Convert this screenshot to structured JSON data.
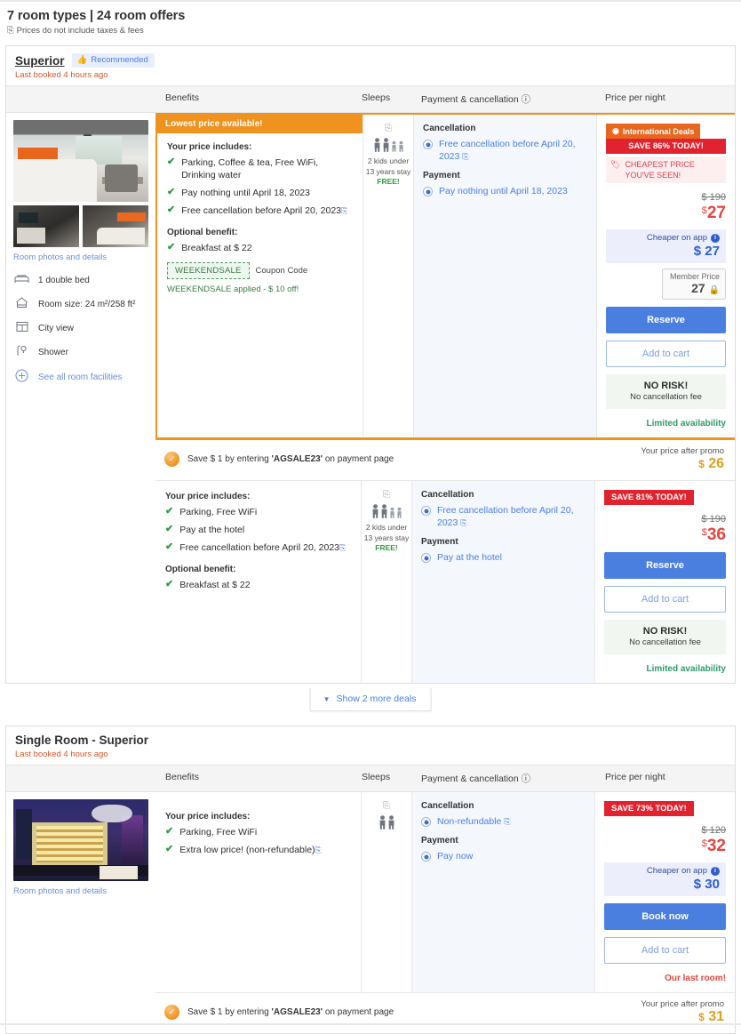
{
  "header": {
    "title": "7 room types | 24 room offers",
    "subtitle": "Prices do not include taxes & fees",
    "subtitle_icon": "external-link-icon"
  },
  "columns": {
    "benefits": "Benefits",
    "sleeps": "Sleeps",
    "payment": "Payment & cancellation",
    "payment_info_icon": "info-icon",
    "price": "Price per night"
  },
  "rooms": [
    {
      "title": "Superior",
      "recommended_badge": "Recommended",
      "recommended_icon": "thumbs-up-icon",
      "last_booked": "Last booked 4 hours ago",
      "photos_link": "Room photos and details",
      "facilities": [
        {
          "icon": "bed-icon",
          "label": "1 double bed"
        },
        {
          "icon": "room-size-icon",
          "label": "Room size: 24 m²/258 ft²"
        },
        {
          "icon": "window-icon",
          "label": "City view"
        },
        {
          "icon": "shower-icon",
          "label": "Shower"
        },
        {
          "icon": "plus-circle-icon",
          "label": "See all room facilities"
        }
      ],
      "offers": [
        {
          "promoted": true,
          "lowest_banner": "Lowest price available!",
          "includes_heading": "Your price includes:",
          "includes": [
            "Parking, Coffee & tea, Free WiFi, Drinking water",
            "Pay nothing until April 18, 2023",
            "Free cancellation before April 20, 2023"
          ],
          "optional_heading": "Optional benefit:",
          "optional": [
            "Breakfast at $ 22"
          ],
          "coupon_code": "WEEKENDSALE",
          "coupon_label": "Coupon Code",
          "coupon_applied": "WEEKENDSALE applied - $ 10 off!",
          "sleeps": {
            "gallery_icon": "photo-icon",
            "adults": 2,
            "kids": 2,
            "note": "2 kids under 13 years stay",
            "free": "FREE!"
          },
          "cancellation_heading": "Cancellation",
          "cancellation_value": "Free cancellation before April 20, 2023",
          "payment_heading": "Payment",
          "payment_value": "Pay nothing until April 18, 2023",
          "international_deal": "International Deals",
          "international_deal_icon": "clock-icon",
          "save_today": "SAVE 86% TODAY!",
          "cheapest_flag": "CHEAPEST PRICE YOU'VE SEEN!",
          "cheapest_icon": "tag-icon",
          "strike_price": "$ 190",
          "currency": "$",
          "price": "27",
          "app_label": "Cheaper on app",
          "app_price": "$ 27",
          "member_label": "Member Price",
          "member_price": "27",
          "member_lock_icon": "lock-icon",
          "reserve_label": "Reserve",
          "cart_label": "Add to cart",
          "norisk_title": "NO RISK!",
          "norisk_sub": "No cancellation fee",
          "availability": "Limited availability",
          "promo_text_pre": "Save $ 1 by entering ",
          "promo_code": "'AGSALE23'",
          "promo_text_post": " on payment page",
          "promo_after_label": "Your price after promo",
          "promo_after_price": "26",
          "promo_currency": "$"
        },
        {
          "promoted": false,
          "includes_heading": "Your price includes:",
          "includes": [
            "Parking, Free WiFi",
            "Pay at the hotel",
            "Free cancellation before April 20, 2023"
          ],
          "optional_heading": "Optional benefit:",
          "optional": [
            "Breakfast at $ 22"
          ],
          "sleeps": {
            "gallery_icon": "photo-icon",
            "adults": 2,
            "kids": 2,
            "note": "2 kids under 13 years stay",
            "free": "FREE!"
          },
          "cancellation_heading": "Cancellation",
          "cancellation_value": "Free cancellation before April 20, 2023",
          "payment_heading": "Payment",
          "payment_value": "Pay at the hotel",
          "save_today": "SAVE 81% TODAY!",
          "strike_price": "$ 190",
          "currency": "$",
          "price": "36",
          "reserve_label": "Reserve",
          "cart_label": "Add to cart",
          "norisk_title": "NO RISK!",
          "norisk_sub": "No cancellation fee",
          "availability": "Limited availability"
        }
      ],
      "show_more": "Show 2 more deals",
      "show_more_icon": "chevron-down-icon"
    },
    {
      "title": "Single Room - Superior",
      "last_booked": "Last booked 4 hours ago",
      "photos_link": "Room photos and details",
      "offers": [
        {
          "promoted": false,
          "includes_heading": "Your price includes:",
          "includes": [
            "Parking, Free WiFi",
            "Extra low price! (non-refundable)"
          ],
          "sleeps": {
            "gallery_icon": "photo-icon",
            "adults": 2,
            "kids": 0
          },
          "cancellation_heading": "Cancellation",
          "cancellation_value": "Non-refundable",
          "payment_heading": "Payment",
          "payment_value": "Pay now",
          "save_today": "SAVE 73% TODAY!",
          "strike_price": "$ 120",
          "currency": "$",
          "price": "32",
          "app_label": "Cheaper on app",
          "app_price": "$ 30",
          "book_label": "Book now",
          "cart_label": "Add to cart",
          "availability": "Our last room!",
          "promo_text_pre": "Save $ 1 by entering ",
          "promo_code": "'AGSALE23'",
          "promo_text_post": " on payment page",
          "promo_after_label": "Your price after promo",
          "promo_after_price": "31",
          "promo_currency": "$"
        }
      ]
    }
  ],
  "colors": {
    "orange": "#f0921e",
    "red": "#e0232e",
    "blue": "#4a7fe0",
    "green": "#2e9b3f",
    "gold": "#d9a020"
  }
}
